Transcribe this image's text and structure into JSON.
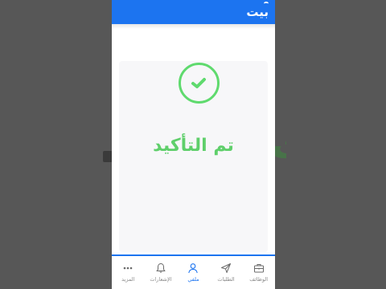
{
  "app": {
    "logo_text": "بيت"
  },
  "confirmation": {
    "title": "تم التأكيد"
  },
  "tabs": [
    {
      "key": "more",
      "label": "المزيد",
      "icon": "more-dots-icon",
      "active": false
    },
    {
      "key": "notifications",
      "label": "الإشعارات",
      "icon": "bell-icon",
      "active": false
    },
    {
      "key": "profile",
      "label": "ملفي",
      "icon": "user-icon",
      "active": true
    },
    {
      "key": "applications",
      "label": "الطلبات",
      "icon": "send-icon",
      "active": false
    },
    {
      "key": "jobs",
      "label": "الوظائف",
      "icon": "briefcase-icon",
      "active": false
    }
  ],
  "colors": {
    "brand_blue": "#1c74f0",
    "success_green": "#5fcf6b",
    "background": "#575757",
    "inactive_label": "#8a8a8a"
  }
}
